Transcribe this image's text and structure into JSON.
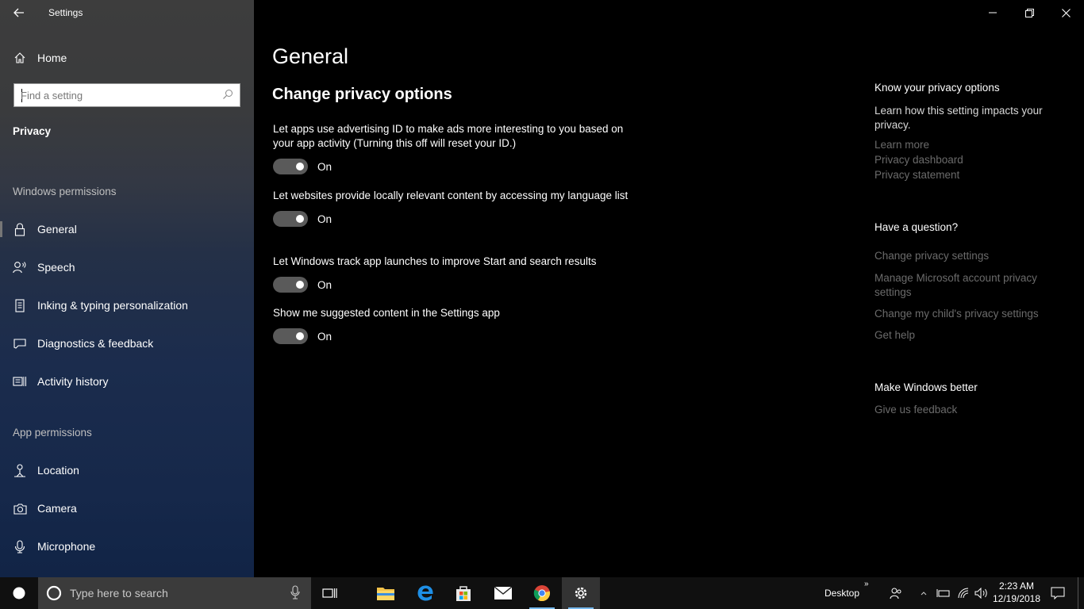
{
  "window": {
    "title": "Settings",
    "caption_buttons": [
      "minimize",
      "restore",
      "close"
    ]
  },
  "sidebar": {
    "home_label": "Home",
    "search_placeholder": "Find a setting",
    "section_title": "Privacy",
    "windows_permissions": {
      "heading": "Windows permissions",
      "items": [
        {
          "label": "General",
          "icon": "lock-icon",
          "selected": true
        },
        {
          "label": "Speech",
          "icon": "speech-icon"
        },
        {
          "label": "Inking & typing personalization",
          "icon": "inking-icon"
        },
        {
          "label": "Diagnostics & feedback",
          "icon": "diagnostics-icon"
        },
        {
          "label": "Activity history",
          "icon": "activity-history-icon"
        }
      ]
    },
    "app_permissions": {
      "heading": "App permissions",
      "items": [
        {
          "label": "Location",
          "icon": "location-icon"
        },
        {
          "label": "Camera",
          "icon": "camera-icon"
        },
        {
          "label": "Microphone",
          "icon": "microphone-icon"
        }
      ]
    }
  },
  "main": {
    "title": "General",
    "subtitle": "Change privacy options",
    "settings": [
      {
        "description": "Let apps use advertising ID to make ads more interesting to you based on your app activity (Turning this off will reset your ID.)",
        "state": "On"
      },
      {
        "description": "Let websites provide locally relevant content by accessing my language list",
        "state": "On"
      },
      {
        "description": "Let Windows track app launches to improve Start and search results",
        "state": "On"
      },
      {
        "description": "Show me suggested content in the Settings app",
        "state": "On"
      }
    ]
  },
  "right_panel": {
    "know": {
      "heading": "Know your privacy options",
      "text": "Learn how this setting impacts your privacy.",
      "links": [
        "Learn more",
        "Privacy dashboard",
        "Privacy statement"
      ]
    },
    "question": {
      "heading": "Have a question?",
      "links": [
        "Change privacy settings",
        "Manage Microsoft account privacy settings",
        "Change my child's privacy settings",
        "Get help"
      ]
    },
    "better": {
      "heading": "Make Windows better",
      "links": [
        "Give us feedback"
      ]
    }
  },
  "taskbar": {
    "search_placeholder": "Type here to search",
    "desktop_label": "Desktop",
    "time": "2:23 AM",
    "date": "12/19/2018",
    "accent_color": "#76b9ed"
  }
}
